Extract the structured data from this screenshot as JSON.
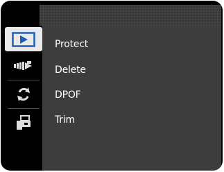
{
  "menu": {
    "items": [
      {
        "label": "Protect"
      },
      {
        "label": "Delete"
      },
      {
        "label": "DPOF"
      },
      {
        "label": "Trim"
      }
    ]
  },
  "sidebar": {
    "items": [
      {
        "icon": "playback-icon",
        "selected": true
      },
      {
        "icon": "slideshow-icon",
        "selected": false
      },
      {
        "icon": "rotate-icon",
        "selected": false
      },
      {
        "icon": "print-settings-icon",
        "selected": false
      }
    ]
  },
  "colors": {
    "accent": "#1e5fb4",
    "panel": "#3d3d3d",
    "header": "#3a3a3a",
    "selected_tab": "#e9e9e9"
  }
}
